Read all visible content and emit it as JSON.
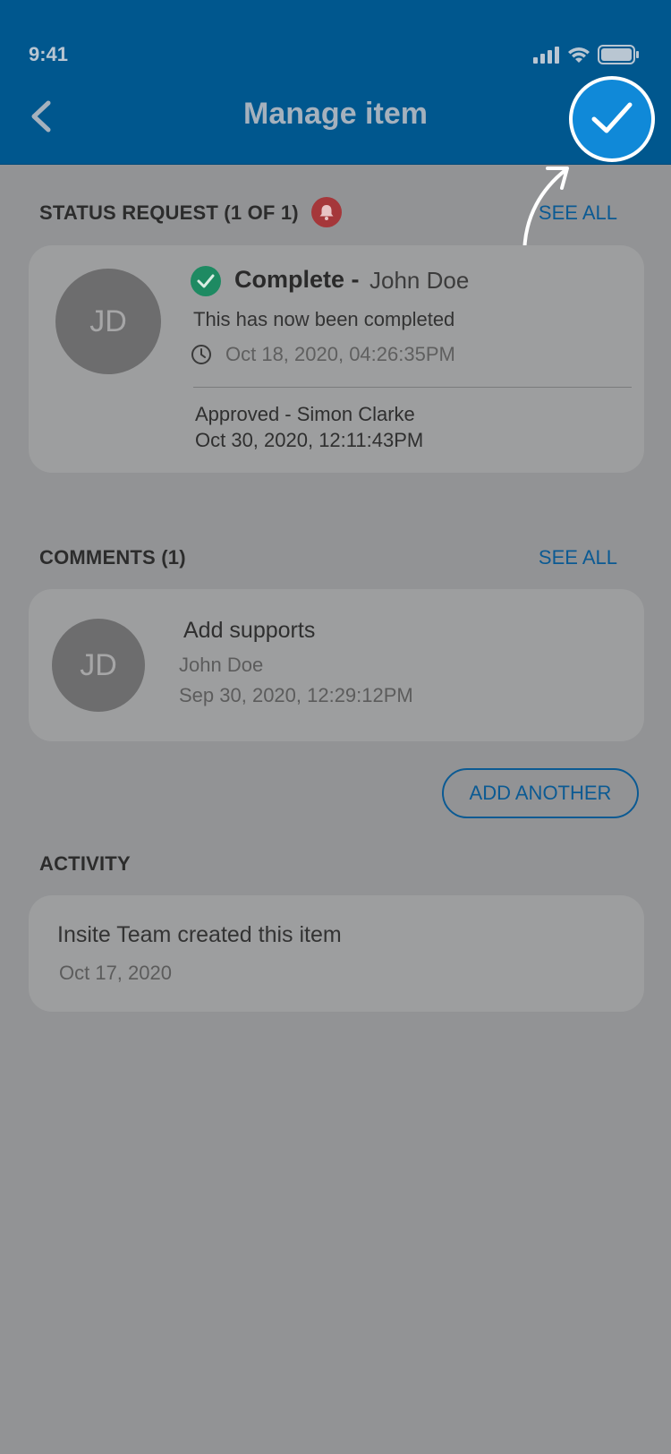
{
  "status_bar": {
    "time": "9:41"
  },
  "header": {
    "title": "Manage item"
  },
  "status_request": {
    "section_title": "STATUS REQUEST (1 OF 1)",
    "see_all": "SEE ALL",
    "avatar_initials": "JD",
    "status_label": "Complete -",
    "status_user": "John Doe",
    "message": "This has now been completed",
    "timestamp": "Oct 18, 2020, 04:26:35PM",
    "approval": "Approved - Simon Clarke",
    "approval_timestamp": "Oct 30, 2020, 12:11:43PM"
  },
  "comments": {
    "section_title": "COMMENTS (1)",
    "see_all": "SEE ALL",
    "avatar_initials": "JD",
    "text": "Add supports",
    "author": "John Doe",
    "timestamp": "Sep 30, 2020, 12:29:12PM",
    "add_button": "ADD ANOTHER"
  },
  "activity": {
    "section_title": "ACTIVITY",
    "text": "Insite Team created this item",
    "date": "Oct 17, 2020"
  },
  "colors": {
    "header_bg": "#00578e",
    "confirm_bg": "#1089d8",
    "overlay_bg": "#929395",
    "link": "#0b5a93",
    "bell": "#a5373a",
    "check": "#1e8a62"
  }
}
